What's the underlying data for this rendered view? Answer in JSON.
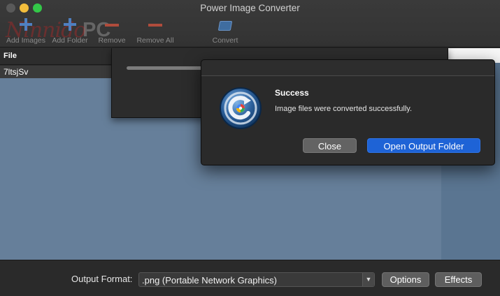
{
  "window": {
    "title": "Power Image Converter"
  },
  "watermark": {
    "text": "Ninnido",
    "pc": "PC"
  },
  "toolbar": {
    "add_images": "Add Images",
    "add_folder": "Add Folder",
    "remove": "Remove",
    "remove_all": "Remove All",
    "convert": "Convert"
  },
  "file_list": {
    "header": "File",
    "rows": [
      "7ltsjSv"
    ]
  },
  "alert": {
    "title": "Success",
    "message": "Image files were converted successfully.",
    "close_label": "Close",
    "open_folder_label": "Open Output Folder"
  },
  "bottom": {
    "output_format_label": "Output Format:",
    "output_format_value": ".png (Portable Network Graphics)",
    "options_label": "Options",
    "effects_label": "Effects"
  },
  "colors": {
    "accent_button": "#1e63d6",
    "list_background": "#667f9a",
    "close_light": "#595959",
    "minimize_light": "#f2bd3c",
    "maximize_light": "#33c748"
  },
  "icons": {
    "app": "power-image-converter-app-icon",
    "add": "plus-icon",
    "remove": "minus-icon",
    "convert": "convert-icon",
    "dropdown": "chevron-down-icon"
  }
}
